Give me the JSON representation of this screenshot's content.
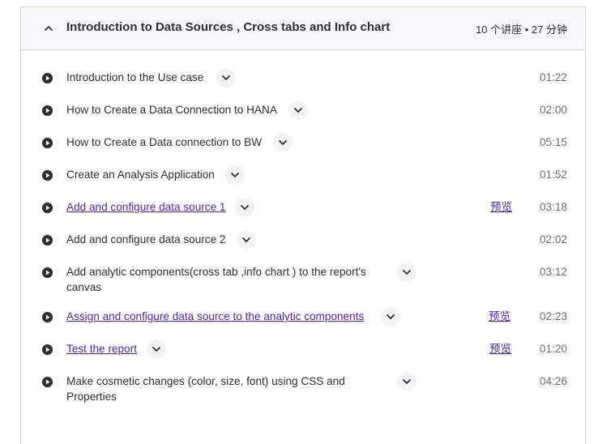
{
  "section": {
    "title": "Introduction to Data Sources , Cross tabs and Info chart",
    "meta": "10 个讲座 • 27 分钟"
  },
  "icons": {
    "collapse": "chevron-up-icon",
    "play": "play-circle-icon",
    "expand": "chevron-down-icon"
  },
  "colors": {
    "link": "#5022c3",
    "text": "#2d2f31",
    "muted": "#6a6f73",
    "header_bg": "#f7f9fa",
    "border": "#d1d7dc"
  },
  "lectures": [
    {
      "title": "Introduction to the Use case",
      "duration": "01:22",
      "preview": ""
    },
    {
      "title": "How to Create a Data Connection to HANA",
      "duration": "02:00",
      "preview": ""
    },
    {
      "title": "How to Create a Data connection to BW",
      "duration": "05:15",
      "preview": ""
    },
    {
      "title": "Create an Analysis Application",
      "duration": "01:52",
      "preview": ""
    },
    {
      "title": "Add and configure data source 1",
      "duration": "03:18",
      "preview": "预览"
    },
    {
      "title": "Add and configure data source 2",
      "duration": "02:02",
      "preview": ""
    },
    {
      "title_line1": "Add analytic components(cross tab ,info chart ) to the report's",
      "title_line2": "canvas",
      "duration": "03:12",
      "preview": ""
    },
    {
      "title": "Assign and configure data source to the analytic components",
      "duration": "02:23",
      "preview": "预览"
    },
    {
      "title": "Test the report",
      "duration": "01:20",
      "preview": "预览"
    },
    {
      "title_line1": "Make cosmetic changes (color, size, font) using CSS and",
      "title_line2": "Properties",
      "duration": "04:26",
      "preview": ""
    }
  ]
}
